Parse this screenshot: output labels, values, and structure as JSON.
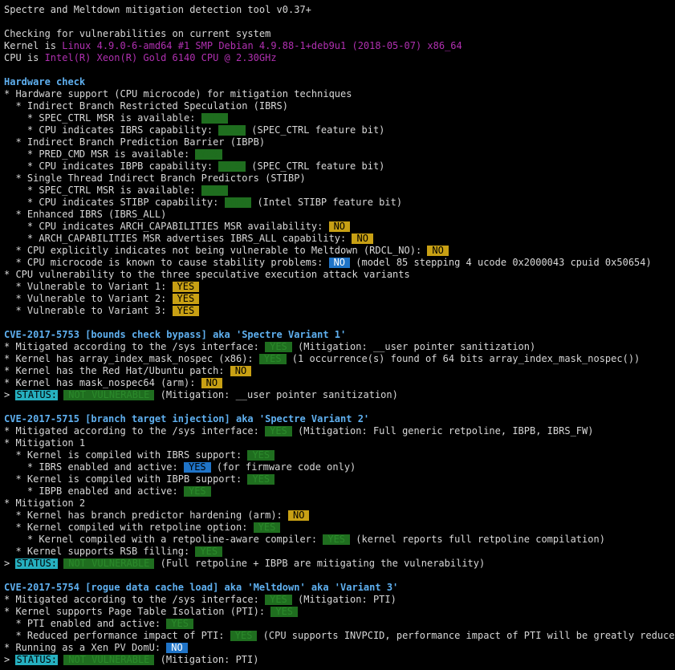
{
  "title": "Spectre and Meltdown mitigation detection tool v0.37+",
  "checking": "Checking for vulnerabilities on current system",
  "kernel_label": "Kernel is ",
  "kernel_value": "Linux 4.9.0-6-amd64 #1 SMP Debian 4.9.88-1+deb9u1 (2018-05-07) x86_64",
  "cpu_label": "CPU is ",
  "cpu_value": "Intel(R) Xeon(R) Gold 6140 CPU @ 2.30GHz",
  "hw": {
    "heading": "Hardware check",
    "l1": "* Hardware support (CPU microcode) for mitigation techniques",
    "l2": "  * Indirect Branch Restricted Speculation (IBRS)",
    "l3": "    * SPEC_CTRL MSR is available: ",
    "l3b": "YES",
    "l4": "    * CPU indicates IBRS capability: ",
    "l4b": "YES",
    "l4t": " (SPEC_CTRL feature bit)",
    "l5": "  * Indirect Branch Prediction Barrier (IBPB)",
    "l6": "    * PRED_CMD MSR is available: ",
    "l6b": "YES",
    "l7": "    * CPU indicates IBPB capability: ",
    "l7b": "YES",
    "l7t": " (SPEC_CTRL feature bit)",
    "l8": "  * Single Thread Indirect Branch Predictors (STIBP)",
    "l9": "    * SPEC_CTRL MSR is available: ",
    "l9b": "YES",
    "l10": "    * CPU indicates STIBP capability: ",
    "l10b": "YES",
    "l10t": " (Intel STIBP feature bit)",
    "l11": "  * Enhanced IBRS (IBRS_ALL)",
    "l12": "    * CPU indicates ARCH_CAPABILITIES MSR availability: ",
    "l12b": "NO",
    "l13": "    * ARCH_CAPABILITIES MSR advertises IBRS_ALL capability: ",
    "l13b": "NO",
    "l14": "  * CPU explicitly indicates not being vulnerable to Meltdown (RDCL_NO): ",
    "l14b": "NO",
    "l15": "  * CPU microcode is known to cause stability problems: ",
    "l15b": "NO",
    "l15t": " (model 85 stepping 4 ucode 0x2000043 cpuid 0x50654)",
    "l16": "* CPU vulnerability to the three speculative execution attack variants",
    "l17": "  * Vulnerable to Variant 1: ",
    "l17b": "YES",
    "l18": "  * Vulnerable to Variant 2: ",
    "l18b": "YES",
    "l19": "  * Vulnerable to Variant 3: ",
    "l19b": "YES"
  },
  "v1": {
    "heading": "CVE-2017-5753 [bounds check bypass] aka 'Spectre Variant 1'",
    "l1": "* Mitigated according to the /sys interface: ",
    "l1b": "YES",
    "l1t": " (Mitigation: __user pointer sanitization)",
    "l2": "* Kernel has array_index_mask_nospec (x86): ",
    "l2b": "YES",
    "l2t": " (1 occurrence(s) found of 64 bits array_index_mask_nospec())",
    "l3": "* Kernel has the Red Hat/Ubuntu patch: ",
    "l3b": "NO",
    "l4": "* Kernel has mask_nospec64 (arm): ",
    "l4b": "NO",
    "status_prefix": "> ",
    "status_label": "STATUS:",
    "status_value": "NOT VULNERABLE",
    "status_text": " (Mitigation: __user pointer sanitization)"
  },
  "v2": {
    "heading": "CVE-2017-5715 [branch target injection] aka 'Spectre Variant 2'",
    "l1": "* Mitigated according to the /sys interface: ",
    "l1b": "YES",
    "l1t": " (Mitigation: Full generic retpoline, IBPB, IBRS_FW)",
    "l2": "* Mitigation 1",
    "l3": "  * Kernel is compiled with IBRS support: ",
    "l3b": "YES",
    "l4": "    * IBRS enabled and active: ",
    "l4b": "YES",
    "l4t": " (for firmware code only)",
    "l5": "  * Kernel is compiled with IBPB support: ",
    "l5b": "YES",
    "l6": "    * IBPB enabled and active: ",
    "l6b": "YES",
    "l7": "* Mitigation 2",
    "l8": "  * Kernel has branch predictor hardening (arm): ",
    "l8b": "NO",
    "l9": "  * Kernel compiled with retpoline option: ",
    "l9b": "YES",
    "l10": "    * Kernel compiled with a retpoline-aware compiler: ",
    "l10b": "YES",
    "l10t": " (kernel reports full retpoline compilation)",
    "l11": "  * Kernel supports RSB filling: ",
    "l11b": "YES",
    "status_prefix": "> ",
    "status_label": "STATUS:",
    "status_value": "NOT VULNERABLE",
    "status_text": " (Full retpoline + IBPB are mitigating the vulnerability)"
  },
  "v3": {
    "heading": "CVE-2017-5754 [rogue data cache load] aka 'Meltdown' aka 'Variant 3'",
    "l1": "* Mitigated according to the /sys interface: ",
    "l1b": "YES",
    "l1t": " (Mitigation: PTI)",
    "l2": "* Kernel supports Page Table Isolation (PTI): ",
    "l2b": "YES",
    "l3": "  * PTI enabled and active: ",
    "l3b": "YES",
    "l4": "  * Reduced performance impact of PTI: ",
    "l4b": "YES",
    "l4t": " (CPU supports INVPCID, performance impact of PTI will be greatly reduced)",
    "l5": "* Running as a Xen PV DomU: ",
    "l5b": "NO",
    "status_prefix": "> ",
    "status_label": "STATUS:",
    "status_value": "NOT VULNERABLE",
    "status_text": " (Mitigation: PTI)"
  },
  "colors": {
    "background": "#000000",
    "text": "#d8d8d8",
    "heading": "#5fb0f0",
    "info": "#b030b0",
    "ok_badge": "#1f6e1f",
    "warn_badge": "#c8a014",
    "info_badge": "#1f74c8",
    "status_badge": "#26b0c0"
  }
}
